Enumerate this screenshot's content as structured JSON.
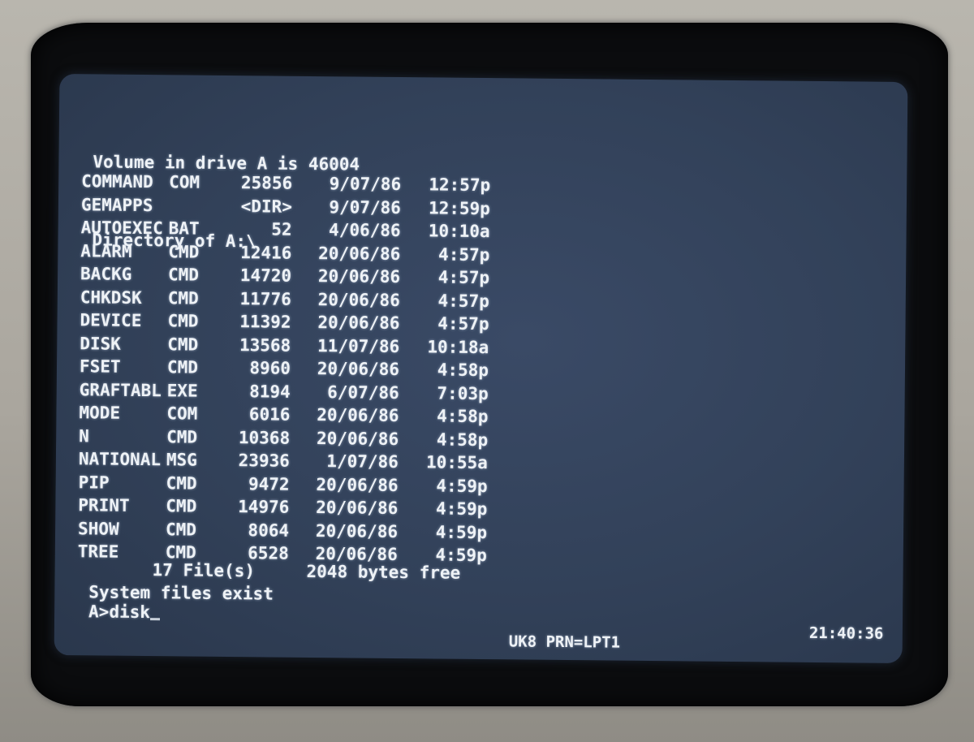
{
  "screen": {
    "volume_line": "Volume in drive A is 46004",
    "directory_line": "Directory of A:\\",
    "files": [
      {
        "name": "COMMAND",
        "ext": "COM",
        "size": "25856",
        "date": "9/07/86",
        "time": "12:57p"
      },
      {
        "name": "GEMAPPS",
        "ext": "",
        "size": "<DIR>",
        "date": "9/07/86",
        "time": "12:59p"
      },
      {
        "name": "AUTOEXEC",
        "ext": "BAT",
        "size": "52",
        "date": "4/06/86",
        "time": "10:10a"
      },
      {
        "name": "ALARM",
        "ext": "CMD",
        "size": "12416",
        "date": "20/06/86",
        "time": "4:57p"
      },
      {
        "name": "BACKG",
        "ext": "CMD",
        "size": "14720",
        "date": "20/06/86",
        "time": "4:57p"
      },
      {
        "name": "CHKDSK",
        "ext": "CMD",
        "size": "11776",
        "date": "20/06/86",
        "time": "4:57p"
      },
      {
        "name": "DEVICE",
        "ext": "CMD",
        "size": "11392",
        "date": "20/06/86",
        "time": "4:57p"
      },
      {
        "name": "DISK",
        "ext": "CMD",
        "size": "13568",
        "date": "11/07/86",
        "time": "10:18a"
      },
      {
        "name": "FSET",
        "ext": "CMD",
        "size": "8960",
        "date": "20/06/86",
        "time": "4:58p"
      },
      {
        "name": "GRAFTABL",
        "ext": "EXE",
        "size": "8194",
        "date": "6/07/86",
        "time": "7:03p"
      },
      {
        "name": "MODE",
        "ext": "COM",
        "size": "6016",
        "date": "20/06/86",
        "time": "4:58p"
      },
      {
        "name": "N",
        "ext": "CMD",
        "size": "10368",
        "date": "20/06/86",
        "time": "4:58p"
      },
      {
        "name": "NATIONAL",
        "ext": "MSG",
        "size": "23936",
        "date": "1/07/86",
        "time": "10:55a"
      },
      {
        "name": "PIP",
        "ext": "CMD",
        "size": "9472",
        "date": "20/06/86",
        "time": "4:59p"
      },
      {
        "name": "PRINT",
        "ext": "CMD",
        "size": "14976",
        "date": "20/06/86",
        "time": "4:59p"
      },
      {
        "name": "SHOW",
        "ext": "CMD",
        "size": "8064",
        "date": "20/06/86",
        "time": "4:59p"
      },
      {
        "name": "TREE",
        "ext": "CMD",
        "size": "6528",
        "date": "20/06/86",
        "time": "4:59p"
      }
    ],
    "file_count": "17 File(s)",
    "bytes_free": "2048 bytes free",
    "system_message": "System files exist",
    "prompt": "A>disk",
    "status_left": "UK8 PRN=LPT1",
    "status_clock": "21:40:36"
  },
  "colors": {
    "screen_bg": "#324159",
    "text": "#eef2f6",
    "bezel": "#0b0c0e"
  }
}
